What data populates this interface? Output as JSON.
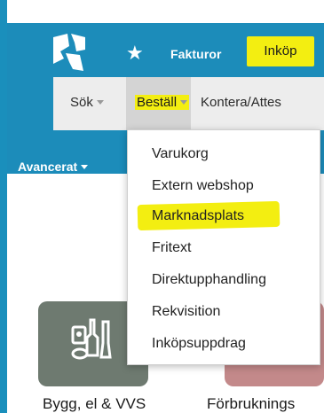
{
  "app": {
    "logo": "company-logo",
    "star": "★"
  },
  "topnav": {
    "items": [
      "Fakturor",
      "Inköp"
    ]
  },
  "subnav": {
    "items": [
      "Sök",
      "Beställ",
      "Kontera/Attes"
    ]
  },
  "advanced_label": "Avancerat",
  "dropdown": {
    "items": [
      "Varukorg",
      "Extern webshop",
      "Marknadsplats",
      "Fritext",
      "Direktupphandling",
      "Rekvisition",
      "Inköpsuppdrag"
    ]
  },
  "tiles": [
    {
      "label": "Bygg, el & VVS",
      "icon": "tools-icon"
    },
    {
      "label": "Förbruknings",
      "icon": ""
    }
  ],
  "colors": {
    "brand": "#1c8cba",
    "highlight": "#f3ee11"
  }
}
